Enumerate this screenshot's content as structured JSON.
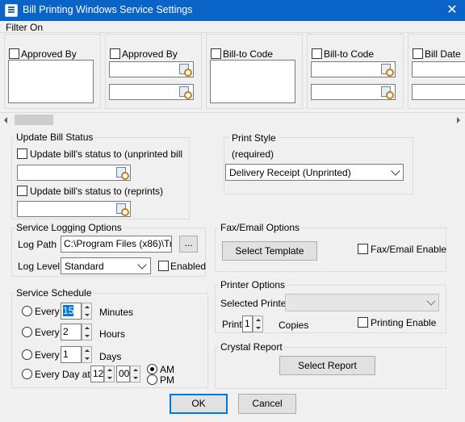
{
  "window": {
    "title": "Bill Printing Windows Service Settings",
    "close_glyph": "✕"
  },
  "filter": {
    "label": "Filter On",
    "columns": [
      {
        "label": "Approved By"
      },
      {
        "label": "Approved By"
      },
      {
        "label": "Bill-to Code"
      },
      {
        "label": "Bill-to Code"
      },
      {
        "label": "Bill Date"
      }
    ]
  },
  "update_status": {
    "label": "Update Bill Status",
    "unprinted_label": "Update bill's status to (unprinted bill",
    "reprints_label": "Update bill's status to (reprints)"
  },
  "print_style": {
    "label": "Print Style",
    "required": "(required)",
    "value": "Delivery Receipt (Unprinted)"
  },
  "logging": {
    "label": "Service Logging Options",
    "log_path_label": "Log Path",
    "log_path_value": "C:\\Program Files (x86)\\Tr",
    "browse_label": "...",
    "log_level_label": "Log Level",
    "log_level_value": "Standard",
    "enabled_label": "Enabled"
  },
  "fax": {
    "label": "Fax/Email Options",
    "template_button": "Select Template",
    "enable_label": "Fax/Email Enable"
  },
  "schedule": {
    "label": "Service Schedule",
    "every": "Every",
    "minutes_value": "15",
    "minutes_label": "Minutes",
    "hours_value": "2",
    "hours_label": "Hours",
    "days_value": "1",
    "days_label": "Days",
    "every_day_label": "Every Day at",
    "hour_value": "12",
    "minute_value": "00",
    "am_label": "AM",
    "pm_label": "PM"
  },
  "printer": {
    "label": "Printer Options",
    "selected_label": "Selected Printer",
    "print_label": "Print",
    "copies_value": "1",
    "copies_label": "Copies",
    "enable_label": "Printing Enable"
  },
  "crystal": {
    "label": "Crystal Report",
    "button": "Select Report"
  },
  "buttons": {
    "ok": "OK",
    "cancel": "Cancel"
  }
}
